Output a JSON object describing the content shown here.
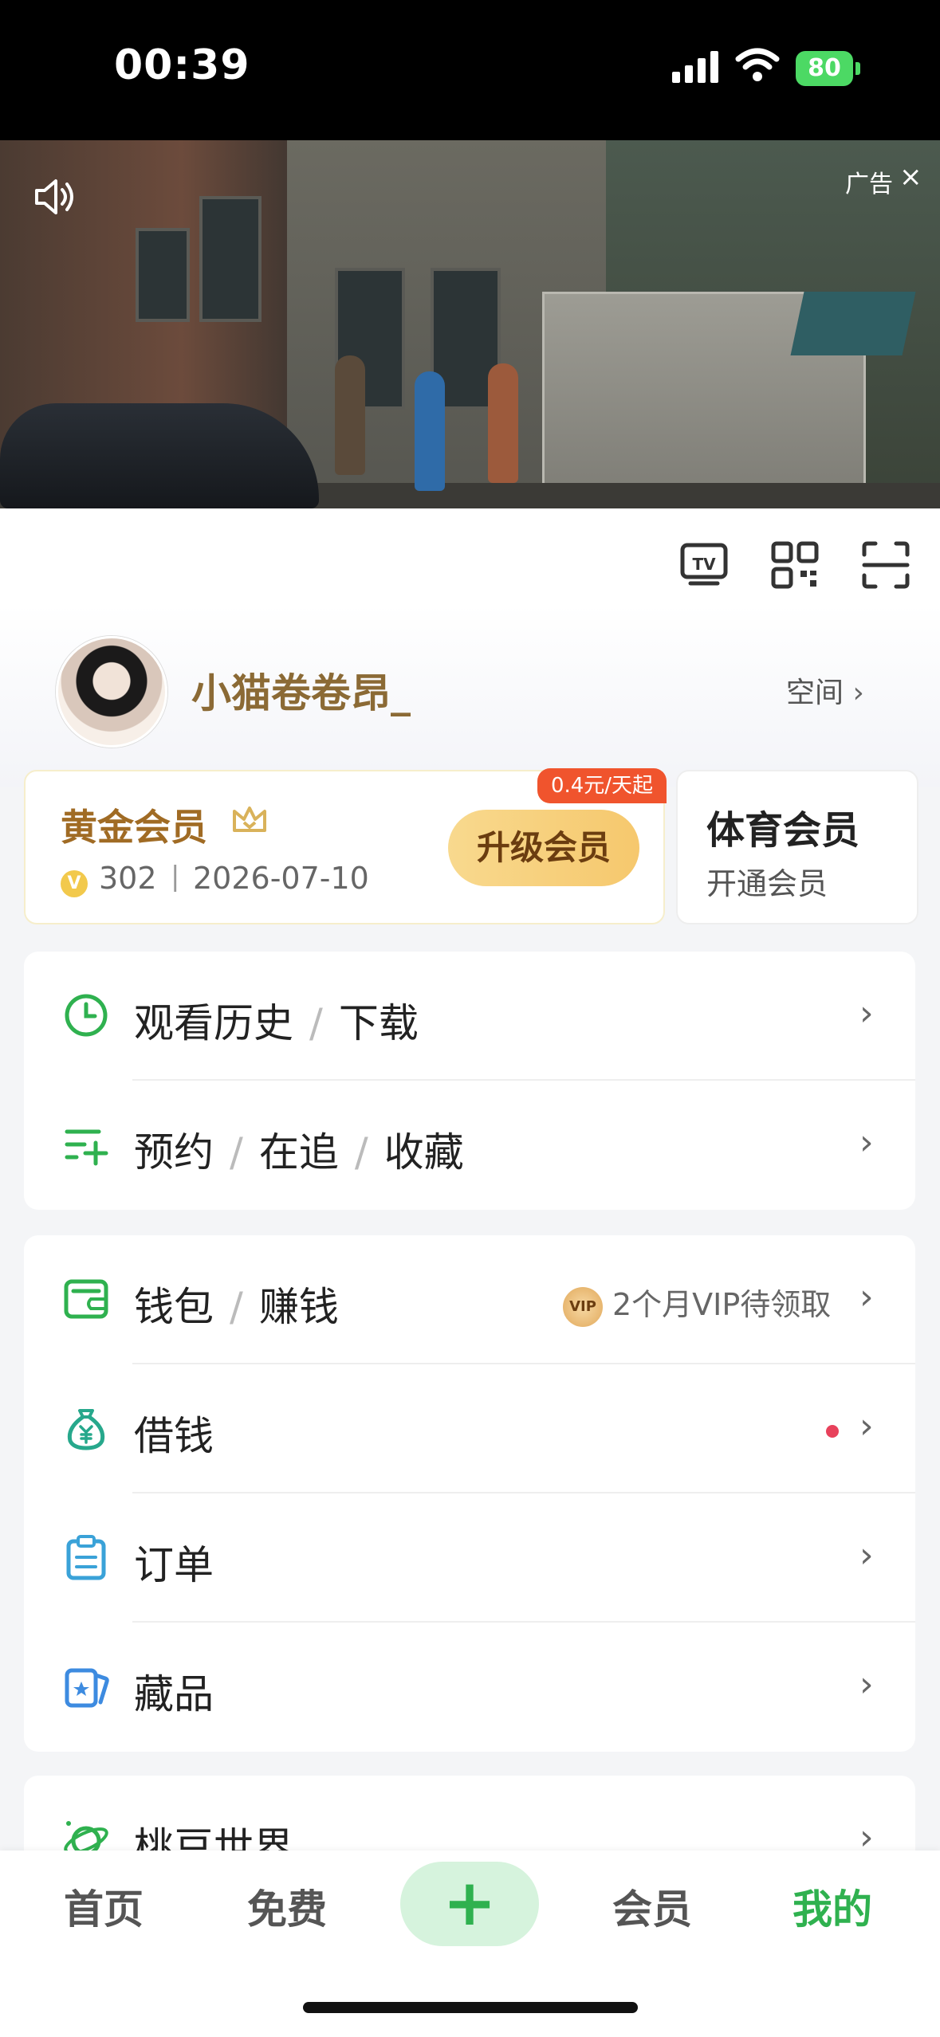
{
  "status_bar": {
    "time": "00:39",
    "battery": "80"
  },
  "ad": {
    "tag": "广告",
    "close": "×"
  },
  "profile": {
    "username": "小猫卷卷昂_",
    "space_label": "空间"
  },
  "vip_card": {
    "title": "黄金会员",
    "coin_icon": "V",
    "points": "302",
    "separator": "|",
    "expiry": "2026-07-10",
    "upgrade_label": "升级会员",
    "price_badge": "0.4元/天起"
  },
  "sport_card": {
    "title": "体育会员",
    "subtitle": "开通会员"
  },
  "menu_group_1": {
    "history": {
      "a": "观看历史",
      "b": "下载"
    },
    "reserve": {
      "a": "预约",
      "b": "在追",
      "c": "收藏"
    }
  },
  "menu_group_2": {
    "wallet": {
      "a": "钱包",
      "b": "赚钱",
      "extra": "2个月VIP待领取",
      "badge": "VIP"
    },
    "loan": {
      "label": "借钱"
    },
    "orders": {
      "label": "订单"
    },
    "collections": {
      "label": "藏品"
    }
  },
  "menu_group_3": {
    "world": {
      "label": "桃豆世界"
    }
  },
  "bottom_nav": {
    "home": "首页",
    "free": "免费",
    "plus": "+",
    "member": "会员",
    "mine": "我的"
  },
  "colors": {
    "accent_green": "#2fb14f",
    "gold": "#a06b24",
    "badge_red": "#f0542d"
  }
}
